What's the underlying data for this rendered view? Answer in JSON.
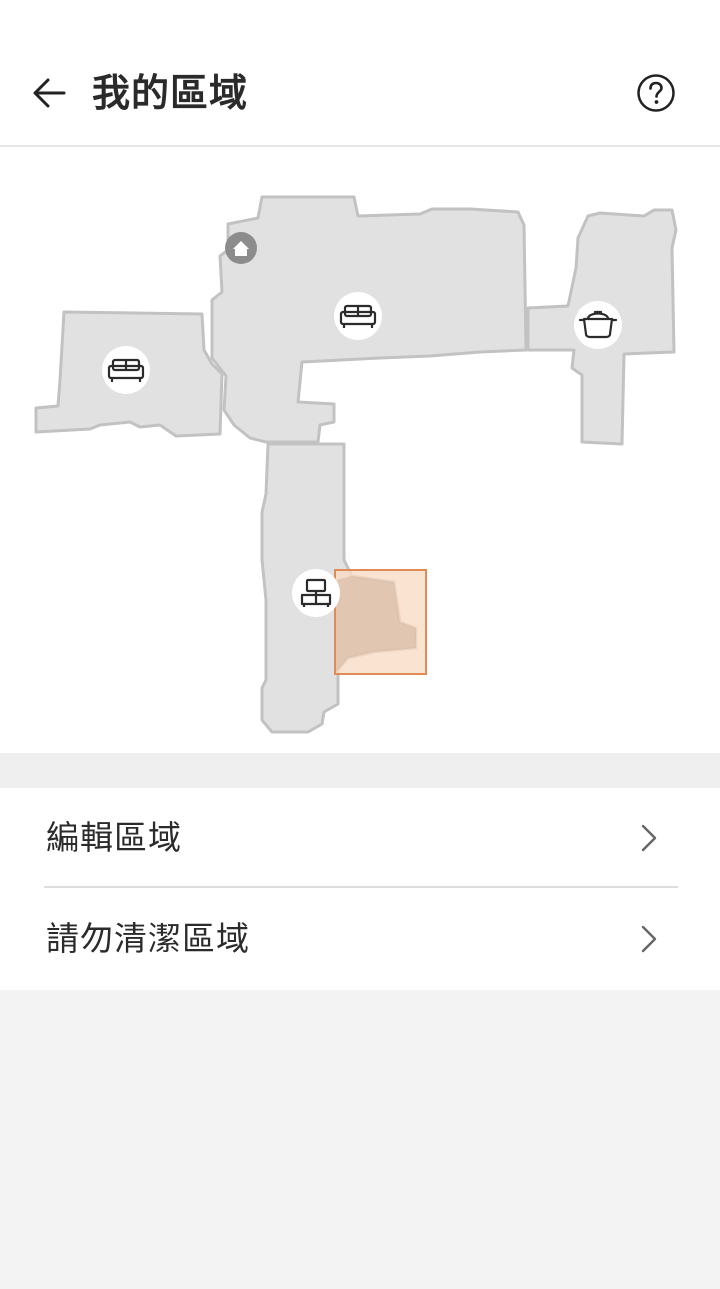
{
  "header": {
    "title": "我的區域",
    "back_icon": "arrow-left-icon",
    "help_icon": "question-circle-icon"
  },
  "map": {
    "room_icons": [
      "sofa-icon",
      "sofa-icon",
      "cooking-pot-icon",
      "tv-cabinet-icon"
    ],
    "dock_icon": "home-icon",
    "colors": {
      "room_fill": "#e1e1e1",
      "room_stroke": "#c2c2c2",
      "zone_fill": "#f8e2d0",
      "zone_stroke": "#e08a55"
    }
  },
  "menu": {
    "items": [
      {
        "label": "編輯區域",
        "icon": "chevron-right-icon"
      },
      {
        "label": "請勿清潔區域",
        "icon": "chevron-right-icon"
      }
    ]
  }
}
